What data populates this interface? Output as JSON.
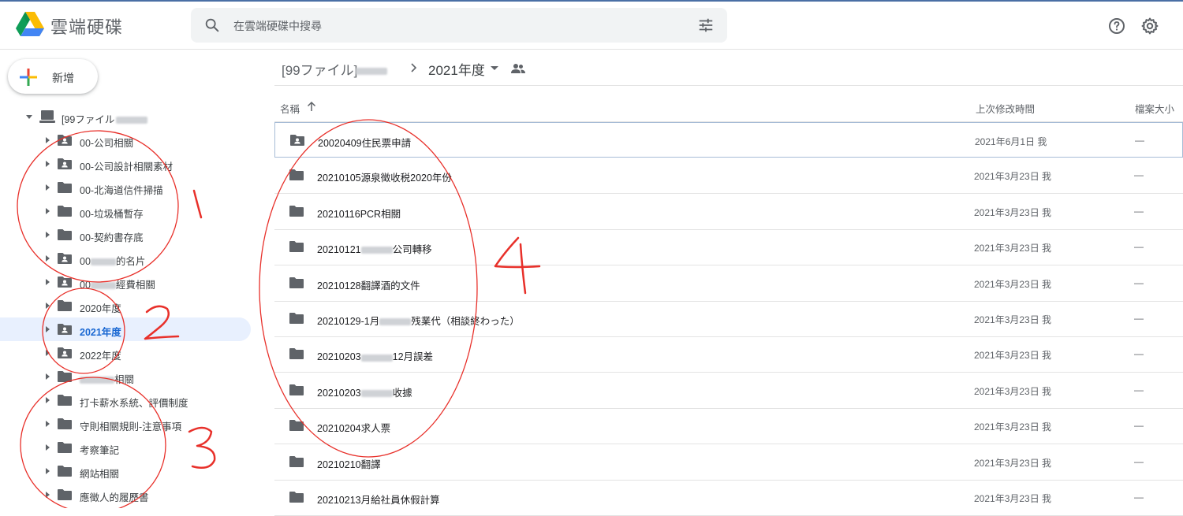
{
  "header": {
    "app_title": "雲端硬碟",
    "search_placeholder": "在雲端硬碟中搜尋"
  },
  "sidebar": {
    "new_label": "新增",
    "root_label": "[99ファイル",
    "items": [
      {
        "label": "00-公司相關",
        "shared": true
      },
      {
        "label": "00-公司設計相關素材",
        "shared": true
      },
      {
        "label": "00-北海道信件掃描",
        "shared": false
      },
      {
        "label": "00-垃圾桶暫存",
        "shared": false
      },
      {
        "label": "00-契約書存底",
        "shared": false
      },
      {
        "label_pre": "00",
        "label_post": "的名片",
        "shared": true
      },
      {
        "label_pre": "00",
        "label_post": "經費相關",
        "shared": true
      },
      {
        "label": "2020年度",
        "shared": false
      },
      {
        "label": "2021年度",
        "shared": true,
        "selected": true
      },
      {
        "label": "2022年度",
        "shared": true
      },
      {
        "label_pre": "",
        "label_post": "相關",
        "shared": false
      },
      {
        "label": "打卡薪水系統、評價制度",
        "shared": false
      },
      {
        "label": "守則相關規則-注意事項",
        "shared": false
      },
      {
        "label": "考察筆記",
        "shared": false
      },
      {
        "label": "網站相關",
        "shared": false
      },
      {
        "label": "應徵人的履歷書",
        "shared": false
      }
    ]
  },
  "breadcrumb": {
    "root": "[99ファイル]",
    "current": "2021年度"
  },
  "columns": {
    "name": "名稱",
    "modified": "上次修改時間",
    "size": "檔案大小"
  },
  "files": [
    {
      "name": "20020409住民票申請",
      "modified": "2021年6月1日 我",
      "size": "—",
      "shared": true,
      "selected": true
    },
    {
      "name": "20210105源泉徵收税2020年份",
      "modified": "2021年3月23日 我",
      "size": "—"
    },
    {
      "name": "20210116PCR相關",
      "modified": "2021年3月23日 我",
      "size": "—"
    },
    {
      "name_pre": "20210121",
      "name_post": "公司轉移",
      "modified": "2021年3月23日 我",
      "size": "—"
    },
    {
      "name": "20210128翻譯酒的文件",
      "modified": "2021年3月23日 我",
      "size": "—"
    },
    {
      "name_pre": "20210129-1月",
      "name_post": "残業代（相談終わった）",
      "modified": "2021年3月23日 我",
      "size": "—"
    },
    {
      "name_pre": "20210203",
      "name_post": "12月誤差",
      "modified": "2021年3月23日 我",
      "size": "—"
    },
    {
      "name_pre": "20210203",
      "name_post": "收據",
      "modified": "2021年3月23日 我",
      "size": "—"
    },
    {
      "name": "20210204求人票",
      "modified": "2021年3月23日 我",
      "size": "—"
    },
    {
      "name": "20210210翻譯",
      "modified": "2021年3月23日 我",
      "size": "—"
    },
    {
      "name": "20210213月給社員休假計算",
      "modified": "2021年3月23日 我",
      "size": "—"
    }
  ],
  "annotations": {
    "n1": "1",
    "n2": "2",
    "n3": "3",
    "n4": "4",
    "color": "#e8302a"
  }
}
